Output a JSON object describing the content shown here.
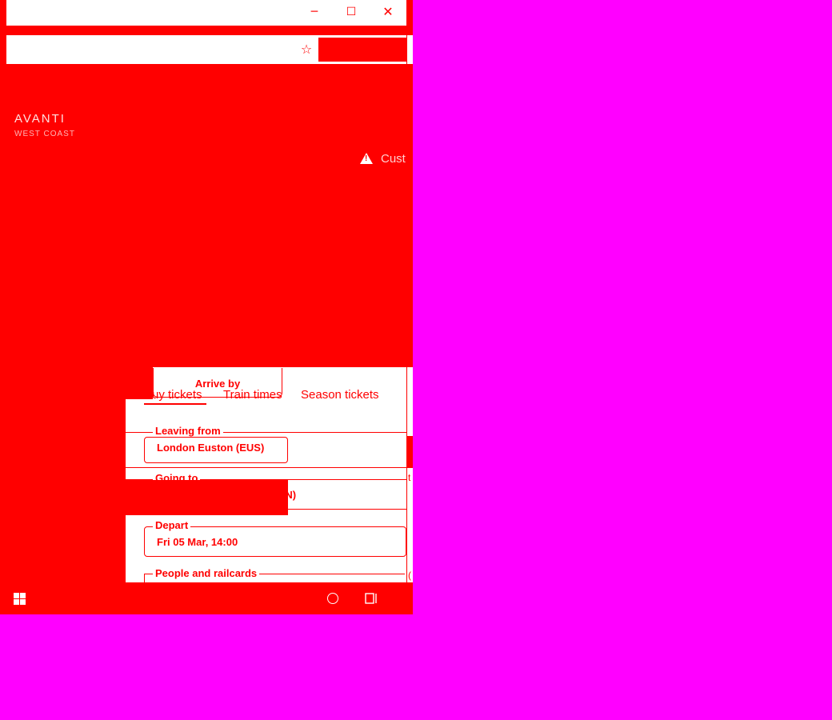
{
  "window": {
    "minimize_glyph": "─",
    "maximize_glyph": "☐",
    "close_glyph": "✕",
    "favorite_glyph": "☆"
  },
  "site": {
    "brand": "AVANTI",
    "brand_sub": "WEST COAST",
    "alert_text": "Cust"
  },
  "planner": {
    "arrive_by_label": "Arrive by",
    "tabs": [
      {
        "label": "Buy tickets",
        "active": true
      },
      {
        "label": "Train times",
        "active": false
      },
      {
        "label": "Season tickets",
        "active": false
      }
    ],
    "leaving_from": {
      "label": "Leaving from",
      "value": "London Euston (EUS)"
    },
    "going_to": {
      "label": "Going to",
      "value_visible": "AN)"
    },
    "depart": {
      "label": "Depart",
      "value": "Fri 05 Mar, 14:00"
    },
    "people": {
      "label": "People and railcards"
    },
    "right_edge_glyph": "t",
    "right_edge_glyph2": "("
  },
  "colors": {
    "accent": "#ff0000",
    "background": "#ff00ff",
    "surface": "#ffffff"
  },
  "icons": [
    "minimize-icon",
    "maximize-icon",
    "close-icon",
    "star-icon",
    "warning-icon",
    "windows-start-icon",
    "cortana-icon",
    "task-view-icon"
  ]
}
